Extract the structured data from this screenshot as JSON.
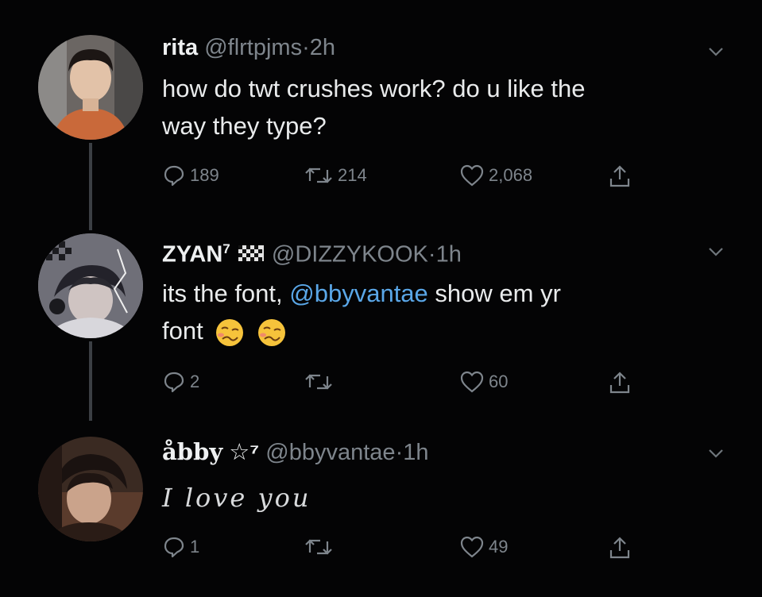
{
  "tweets": [
    {
      "name": "rita",
      "handle": "@flrtpjms",
      "time": "2h",
      "text_lines": [
        "how do twt crushes work? do u like the",
        "way they type?"
      ],
      "replies": "189",
      "retweets": "214",
      "likes": "2,068"
    },
    {
      "name": "ZYAN",
      "name_suffix": "7",
      "handle": "@DIZZYKOOK",
      "time": "1h",
      "text_before": "its the font, ",
      "mention": "@bbyvantae",
      "text_after": " show em yr",
      "text_line2": "font",
      "replies": "2",
      "retweets": "",
      "likes": "60"
    },
    {
      "name": "åbby",
      "name_suffix": "☆⁷",
      "handle": "@bbyvantae",
      "time": "1h",
      "text": "I love you",
      "replies": "1",
      "retweets": "",
      "likes": "49"
    }
  ],
  "icons": {
    "reply": "reply-icon",
    "retweet": "retweet-icon",
    "like": "heart-icon",
    "share": "share-icon",
    "caret": "chevron-down-icon"
  },
  "colors": {
    "background": "#040405",
    "text": "#e9ebec",
    "muted": "#7e858c",
    "mention": "#5aa7e8"
  }
}
